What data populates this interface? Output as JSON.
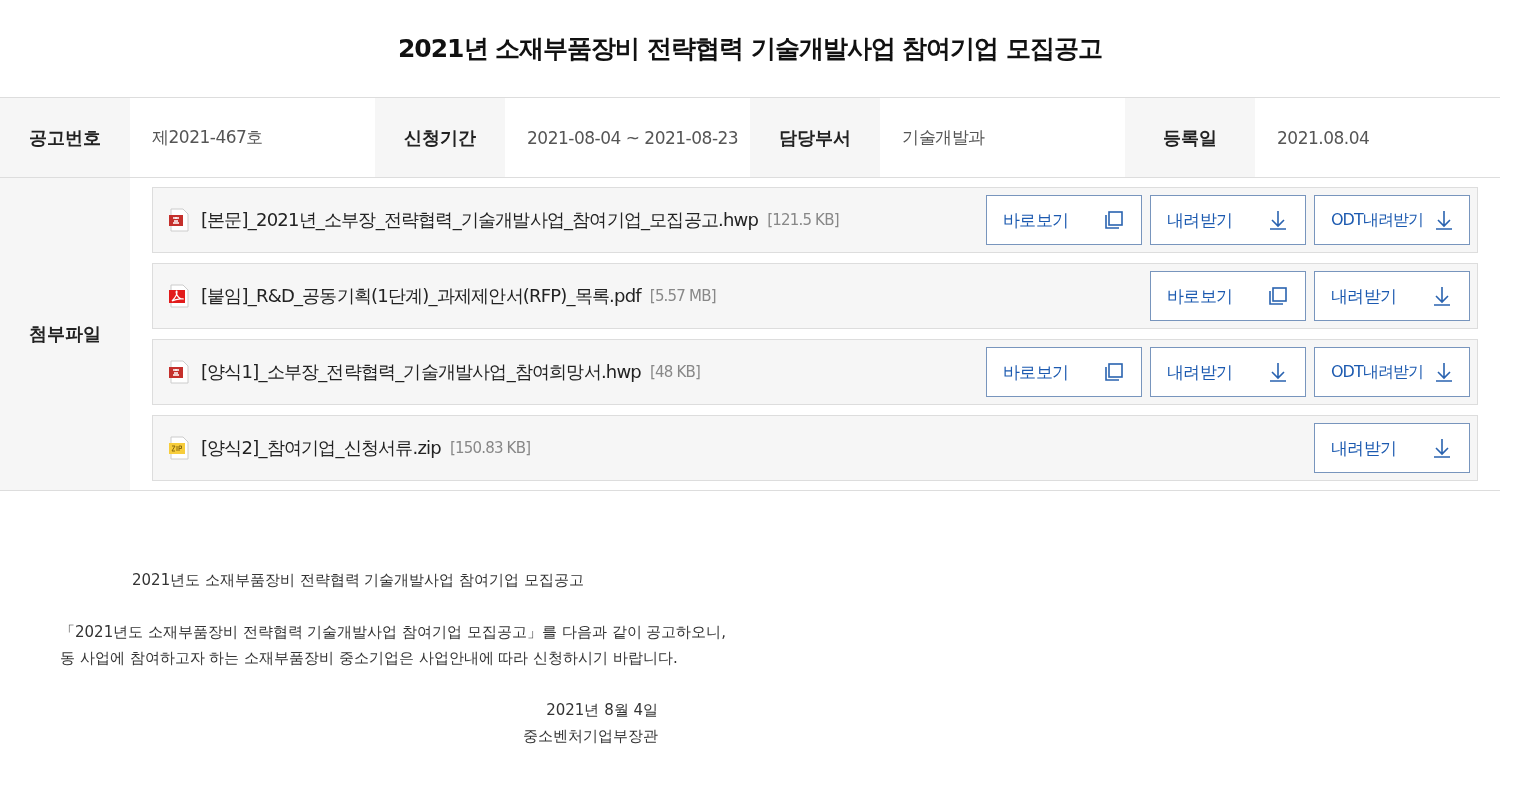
{
  "title": "2021년 소재부품장비 전략협력 기술개발사업 참여기업 모집공고",
  "info": [
    {
      "label": "공고번호",
      "value": "제2021-467호"
    },
    {
      "label": "신청기간",
      "value": "2021-08-04 ~ 2021-08-23"
    },
    {
      "label": "담당부서",
      "value": "기술개발과"
    },
    {
      "label": "등록일",
      "value": "2021.08.04"
    }
  ],
  "attachments": {
    "label": "첨부파일",
    "files": [
      {
        "kind": "hwp",
        "name": "[본문]_2021년_소부장_전략협력_기술개발사업_참여기업_모집공고.hwp",
        "size": "[121.5 KB]",
        "buttons": [
          {
            "kind": "view",
            "label": "바로보기"
          },
          {
            "kind": "download",
            "label": "내려받기"
          },
          {
            "kind": "odt",
            "label": "ODT내려받기"
          }
        ]
      },
      {
        "kind": "pdf",
        "name": "[붙임]_R&D_공동기획(1단계)_과제제안서(RFP)_목록.pdf",
        "size": "[5.57 MB]",
        "buttons": [
          {
            "kind": "view",
            "label": "바로보기"
          },
          {
            "kind": "download",
            "label": "내려받기"
          }
        ]
      },
      {
        "kind": "hwp",
        "name": "[양식1]_소부장_전략협력_기술개발사업_참여희망서.hwp",
        "size": "[48 KB]",
        "buttons": [
          {
            "kind": "view",
            "label": "바로보기"
          },
          {
            "kind": "download",
            "label": "내려받기"
          },
          {
            "kind": "odt",
            "label": "ODT내려받기"
          }
        ]
      },
      {
        "kind": "zip",
        "name": "[양식2]_참여기업_신청서류.zip",
        "size": "[150.83 KB]",
        "buttons": [
          {
            "kind": "download",
            "label": "내려받기"
          }
        ]
      }
    ]
  },
  "body": {
    "heading": "2021년도 소재부품장비 전략협력 기술개발사업 참여기업 모집공고",
    "paragraph": [
      "「2021년도 소재부품장비 전략협력 기술개발사업 참여기업 모집공고」를 다음과 같이 공고하오니,",
      "동 사업에 참여하고자 하는 소재부품장비 중소기업은 사업안내에 따라 신청하시기 바랍니다."
    ],
    "date": "2021년 8월 4일",
    "signature": "중소벤처기업부장관"
  }
}
